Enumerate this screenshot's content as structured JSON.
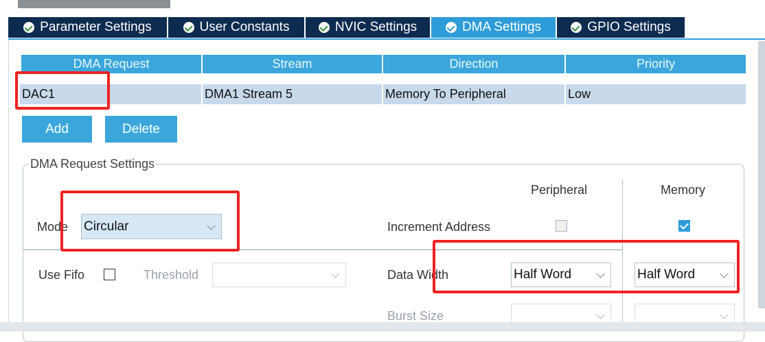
{
  "tabs": [
    {
      "label": "Parameter Settings",
      "active": false
    },
    {
      "label": "User Constants",
      "active": false
    },
    {
      "label": "NVIC Settings",
      "active": false
    },
    {
      "label": "DMA Settings",
      "active": true
    },
    {
      "label": "GPIO Settings",
      "active": false
    }
  ],
  "table": {
    "headers": [
      "DMA Request",
      "Stream",
      "Direction",
      "Priority"
    ],
    "rows": [
      [
        "DAC1",
        "DMA1 Stream 5",
        "Memory To Peripheral",
        "Low"
      ]
    ]
  },
  "buttons": {
    "add": "Add",
    "delete": "Delete"
  },
  "settings": {
    "legend": "DMA Request Settings",
    "col_peripheral": "Peripheral",
    "col_memory": "Memory",
    "mode_label": "Mode",
    "mode_value": "Circular",
    "increment_label": "Increment Address",
    "increment_peripheral": false,
    "increment_memory": true,
    "use_fifo_label": "Use Fifo",
    "use_fifo": false,
    "threshold_label": "Threshold",
    "threshold_value": "",
    "data_width_label": "Data Width",
    "data_width_peripheral": "Half Word",
    "data_width_memory": "Half Word",
    "burst_size_label": "Burst Size"
  },
  "colors": {
    "tab_bg": "#0d2b4f",
    "tab_active": "#2d9cd8",
    "accent": "#3aa6dc",
    "selected_row": "#c7d9ea",
    "highlight": "#ee2222"
  }
}
